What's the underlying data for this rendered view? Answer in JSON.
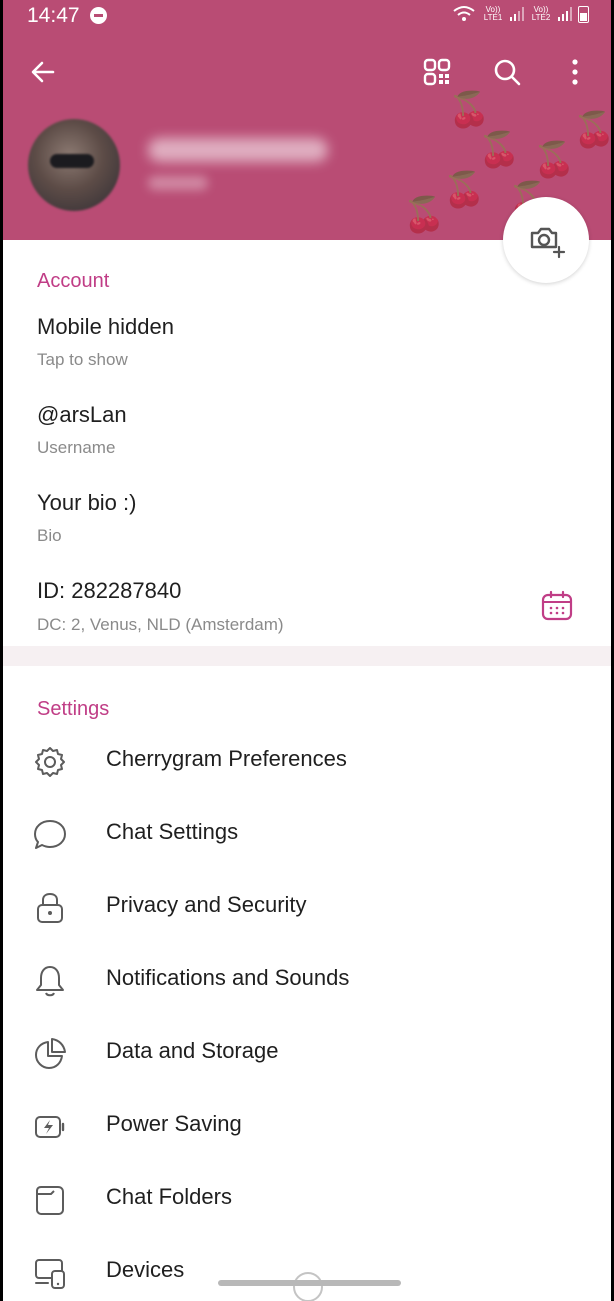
{
  "status_bar": {
    "time": "14:47",
    "sim1": "Vo)) LTE1",
    "sim2": "Vo)) LTE2"
  },
  "toolbar": {
    "back_icon": "arrow-left-icon",
    "qr_icon": "qr-code-icon",
    "search_icon": "search-icon",
    "more_icon": "more-vertical-icon"
  },
  "colors": {
    "header": "#b94c74",
    "accent": "#c03d86"
  },
  "account": {
    "title": "Account",
    "phone": "Mobile hidden",
    "phone_sub": "Tap to show",
    "username": "@arsLan",
    "username_sub": "Username",
    "bio": "Your bio :)",
    "bio_sub": "Bio",
    "id": "ID: 282287840",
    "dc": "DC: 2, Venus, NLD (Amsterdam)"
  },
  "settings": {
    "title": "Settings",
    "items": [
      {
        "label": "Cherrygram Preferences",
        "icon": "gear-icon"
      },
      {
        "label": "Chat Settings",
        "icon": "chat-bubble-icon"
      },
      {
        "label": "Privacy and Security",
        "icon": "lock-icon"
      },
      {
        "label": "Notifications and Sounds",
        "icon": "bell-icon"
      },
      {
        "label": "Data and Storage",
        "icon": "pie-chart-icon"
      },
      {
        "label": "Power Saving",
        "icon": "battery-bolt-icon"
      },
      {
        "label": "Chat Folders",
        "icon": "folder-icon"
      },
      {
        "label": "Devices",
        "icon": "devices-icon"
      }
    ]
  }
}
